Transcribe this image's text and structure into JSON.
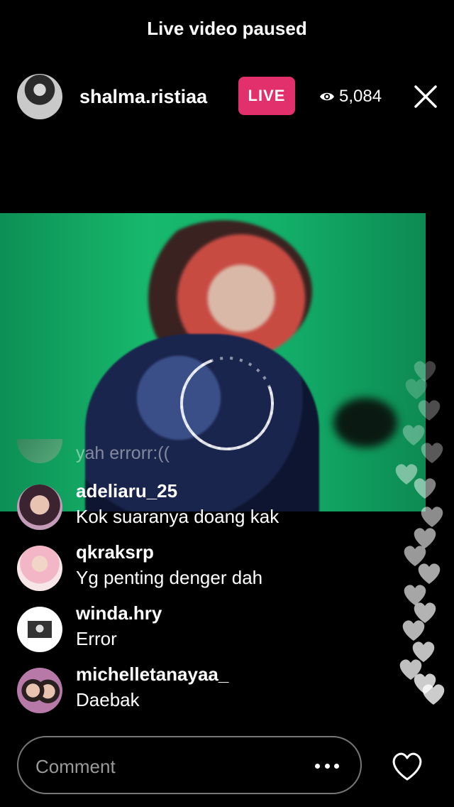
{
  "status": {
    "text": "Live video paused"
  },
  "header": {
    "host_name": "shalma.ristiaa",
    "live_label": "LIVE",
    "viewer_count": "5,084",
    "icons": {
      "viewers": "eye-icon",
      "close": "close-icon"
    }
  },
  "video": {
    "state": "paused",
    "loading_indicator": "spinner"
  },
  "comments": {
    "faded": {
      "text": "yah errorr:(("
    },
    "items": [
      {
        "user": "adeliaru_25",
        "message": "Kok suaranya doang kak"
      },
      {
        "user": "qkraksrp",
        "message": "Yg penting denger dah"
      },
      {
        "user": "winda.hry",
        "message": "Error"
      },
      {
        "user": "michelletanayaa_",
        "message": "Daebak"
      }
    ]
  },
  "composer": {
    "placeholder": "Comment",
    "icons": {
      "more": "more-horizontal-icon",
      "like": "heart-icon"
    }
  },
  "colors": {
    "live_badge": "#e1306c",
    "background": "#000000"
  }
}
